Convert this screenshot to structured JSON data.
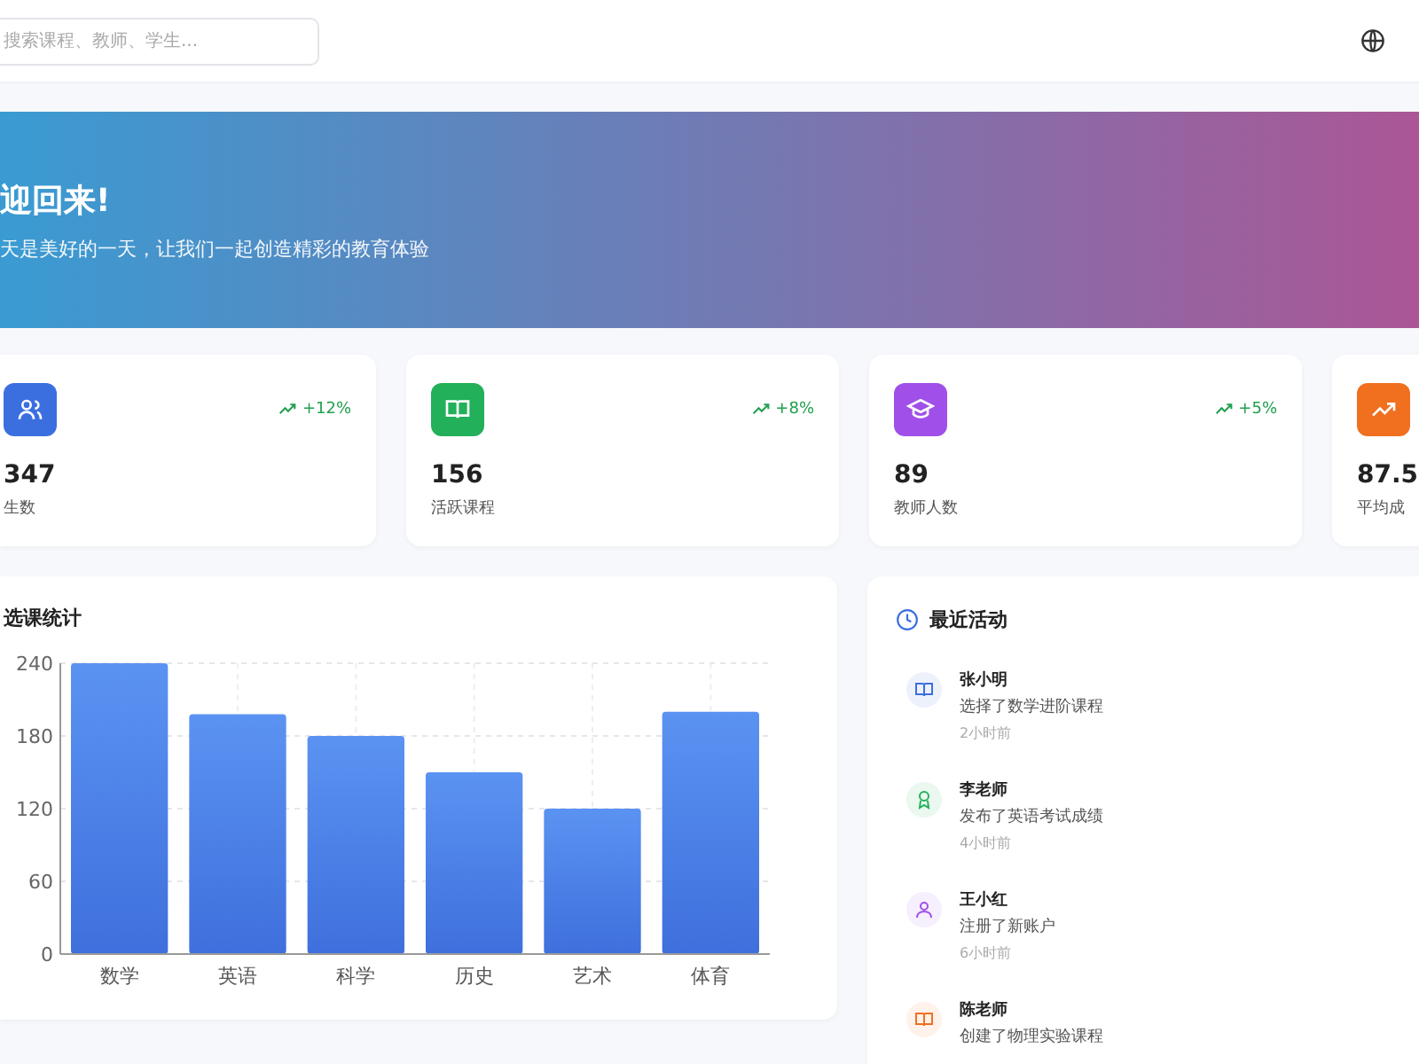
{
  "header": {
    "search": {
      "placeholder": "搜索课程、教师、学生..."
    }
  },
  "banner": {
    "title": "迎回来!",
    "subtitle": "天是美好的一天，让我们一起创造精彩的教育体验"
  },
  "stats": [
    {
      "kind": "users",
      "value": "347",
      "label": "生数",
      "trend": "+12%",
      "color": "#3b6fe0"
    },
    {
      "kind": "book",
      "value": "156",
      "label": "活跃课程",
      "trend": "+8%",
      "color": "#22b05a"
    },
    {
      "kind": "cap",
      "value": "89",
      "label": "教师人数",
      "trend": "+5%",
      "color": "#a050e8"
    },
    {
      "kind": "chart",
      "value": "87.5",
      "label": "平均成",
      "color": "#f07020"
    }
  ],
  "chart_card": {
    "title": "选课统计",
    "chart_data": {
      "type": "bar",
      "categories": [
        "数学",
        "英语",
        "科学",
        "历史",
        "艺术",
        "体育"
      ],
      "values": [
        240,
        198,
        180,
        150,
        120,
        200
      ],
      "ylim": [
        0,
        240
      ],
      "grid": true,
      "yticks": [
        0,
        60,
        120,
        180,
        240
      ]
    }
  },
  "activity": {
    "title": "最近活动",
    "items": [
      {
        "kind": "book",
        "name": "张小明",
        "text": "选择了数学进阶课程",
        "time": "2小时前",
        "color": "#3b6fe0"
      },
      {
        "kind": "award",
        "name": "李老师",
        "text": "发布了英语考试成绩",
        "time": "4小时前",
        "color": "#22b05a"
      },
      {
        "kind": "user",
        "name": "王小红",
        "text": "注册了新账户",
        "time": "6小时前",
        "color": "#a050e8"
      },
      {
        "kind": "book",
        "name": "陈老师",
        "text": "创建了物理实验课程",
        "color": "#f07020"
      }
    ]
  }
}
